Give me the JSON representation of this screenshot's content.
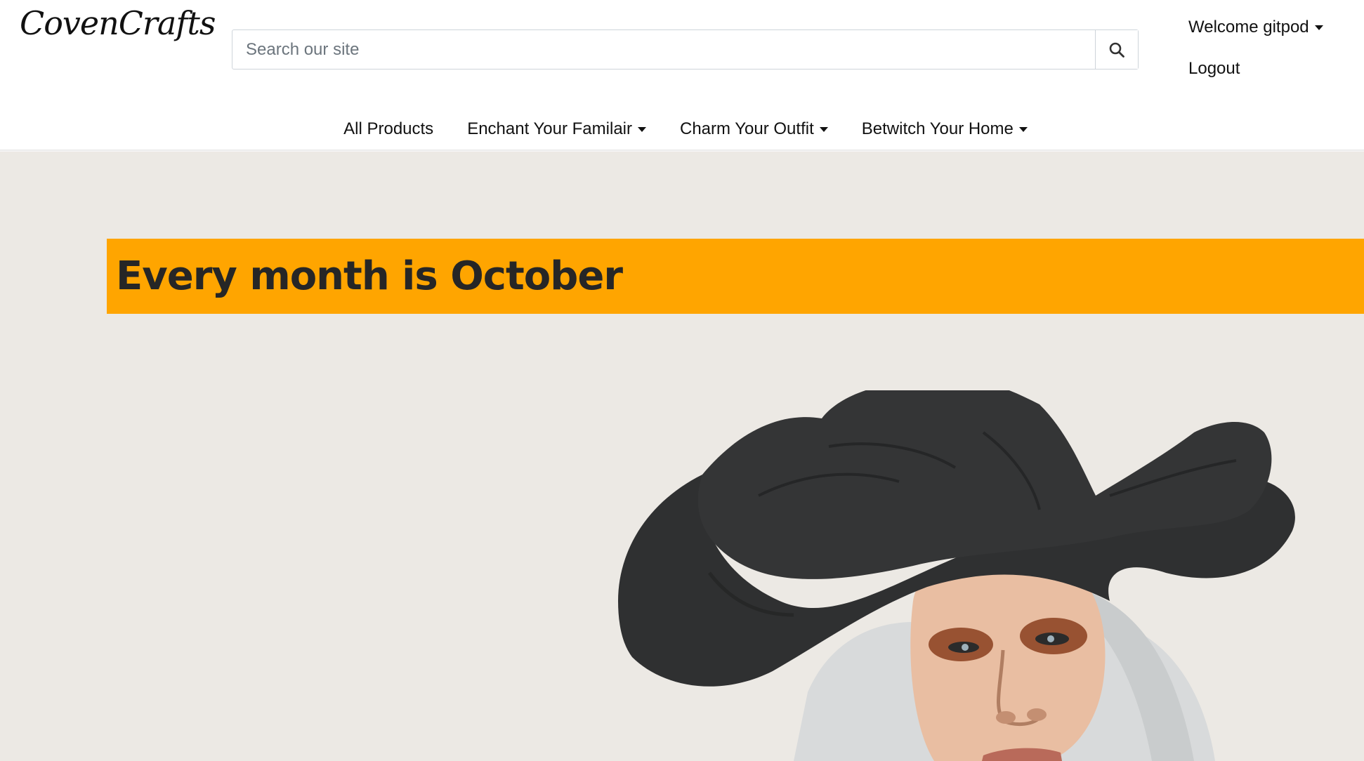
{
  "brand": {
    "logo_text": "CovenCrafts"
  },
  "search": {
    "placeholder": "Search our site",
    "icon": "search-icon"
  },
  "account": {
    "welcome_label": "Welcome gitpod",
    "logout_label": "Logout"
  },
  "nav": {
    "items": [
      {
        "label": "All Products",
        "has_dropdown": false
      },
      {
        "label": "Enchant Your Familair",
        "has_dropdown": true
      },
      {
        "label": "Charm Your Outfit",
        "has_dropdown": true
      },
      {
        "label": "Betwitch Your Home",
        "has_dropdown": true
      }
    ]
  },
  "hero": {
    "title": "Every month is October",
    "banner_color": "#ffa500",
    "background_color": "#ece9e4",
    "image_alt": "Woman in black witch hat"
  }
}
